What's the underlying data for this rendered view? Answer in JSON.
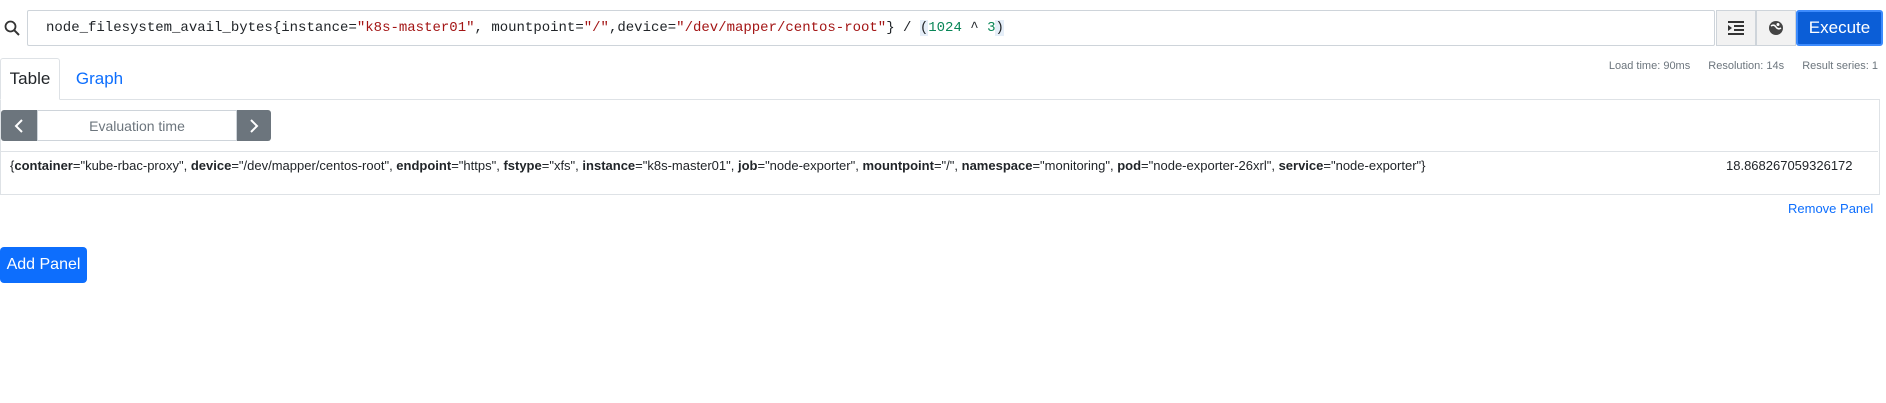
{
  "query": {
    "metric": "node_filesystem_avail_bytes",
    "open_brace": "{",
    "l1_key": "instance=",
    "l1_val": "\"k8s-master01\"",
    "sep1": ", ",
    "l2_key": "mountpoint=",
    "l2_val": "\"/\"",
    "sep2": ",",
    "l3_key": "device=",
    "l3_val": "\"/dev/mapper/centos-root\"",
    "close_brace": "}",
    "divide": " / ",
    "paren_open": "(",
    "num1": "1024",
    "op": " ^ ",
    "num2": "3",
    "paren_close": ")"
  },
  "toolbar": {
    "search_icon": "search-icon",
    "format_icon": "format-icon",
    "explain_icon": "metrics-explorer-icon",
    "execute_label": "Execute"
  },
  "stats": {
    "load_time": "Load time: 90ms",
    "resolution": "Resolution: 14s",
    "result_series": "Result series: 1"
  },
  "tabs": [
    {
      "label": "Table",
      "active": true
    },
    {
      "label": "Graph",
      "active": false
    }
  ],
  "evaluation": {
    "placeholder": "Evaluation time"
  },
  "result": {
    "labels": [
      {
        "key": "container",
        "value": "\"kube-rbac-proxy\""
      },
      {
        "key": "device",
        "value": "\"/dev/mapper/centos-root\""
      },
      {
        "key": "endpoint",
        "value": "\"https\""
      },
      {
        "key": "fstype",
        "value": "\"xfs\""
      },
      {
        "key": "instance",
        "value": "\"k8s-master01\""
      },
      {
        "key": "job",
        "value": "\"node-exporter\""
      },
      {
        "key": "mountpoint",
        "value": "\"/\""
      },
      {
        "key": "namespace",
        "value": "\"monitoring\""
      },
      {
        "key": "pod",
        "value": "\"node-exporter-26xrl\""
      },
      {
        "key": "service",
        "value": "\"node-exporter\""
      }
    ],
    "value": "18.868267059326172"
  },
  "actions": {
    "remove_panel": "Remove Panel",
    "add_panel": "Add Panel"
  },
  "colors": {
    "accent": "#0d6efd",
    "execute": "#0b5ed7",
    "nav_button": "#6c757d"
  }
}
